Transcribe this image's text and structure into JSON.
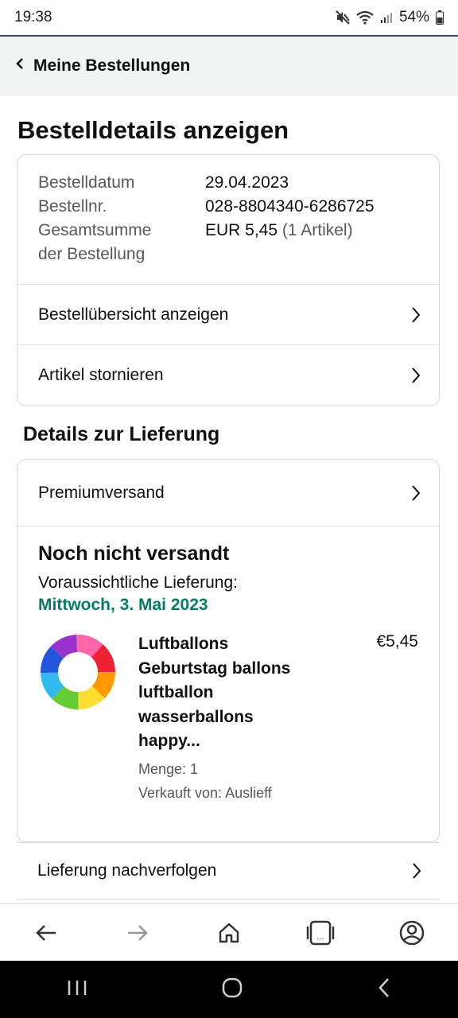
{
  "status_bar": {
    "time": "19:38",
    "battery": "54%",
    "icons": [
      "mute-icon",
      "wifi-icon",
      "signal-icon",
      "battery-icon"
    ]
  },
  "header": {
    "back_label": "Meine Bestellungen"
  },
  "page": {
    "title": "Bestelldetails anzeigen"
  },
  "order_info": {
    "rows": [
      {
        "label": "Bestelldatum",
        "value": "29.04.2023"
      },
      {
        "label": "Bestellnr.",
        "value": "028-8804340-6286725"
      },
      {
        "label_line1": "Gesamtsumme",
        "label_line2": "der Bestellung",
        "value": "EUR 5,45",
        "value_suffix": "(1 Artikel)"
      }
    ]
  },
  "order_actions": {
    "summary": "Bestellübersicht anzeigen",
    "cancel": "Artikel stornieren"
  },
  "delivery": {
    "section_title": "Details zur Lieferung",
    "shipping_method": "Premiumversand",
    "status": "Noch nicht versandt",
    "eta_label": "Voraussichtliche Lieferung:",
    "eta_date": "Mittwoch, 3. Mai 2023",
    "eta_color": "#067d62",
    "item": {
      "title": "Luftballons Geburtstag ballons luftballon wasserballons happy...",
      "price": "€5,45",
      "quantity": "Menge: 1",
      "seller": "Verkauft von: Auslieff"
    },
    "track_label": "Lieferung nachverfolgen"
  },
  "tab_bar": {
    "icons": [
      "back-arrow-icon",
      "forward-arrow-icon",
      "home-icon",
      "tabs-icon",
      "account-icon"
    ]
  },
  "system_nav": {
    "icons": [
      "recent-apps-icon",
      "home-circle-icon",
      "system-back-icon"
    ]
  }
}
